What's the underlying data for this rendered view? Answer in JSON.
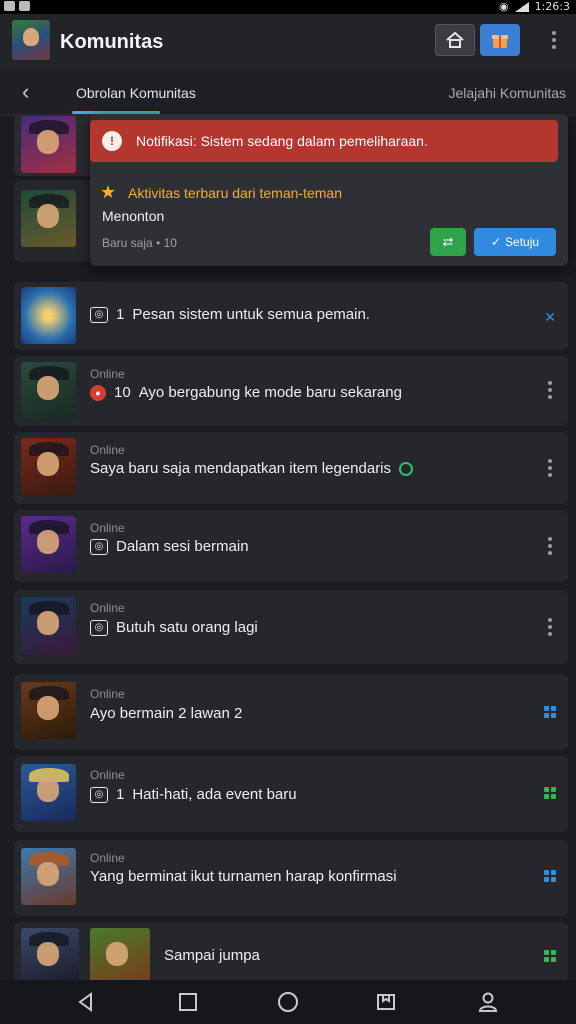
{
  "status_bar": {
    "time": "1:26:3"
  },
  "app": {
    "title": "Komunitas"
  },
  "tabs": [
    {
      "label": "Obrolan Komunitas"
    },
    {
      "label": "Jelajahi Komunitas"
    }
  ],
  "popup": {
    "alert_text": "Notifikasi: Sistem sedang dalam pemeliharaan.",
    "headline": "Aktivitas terbaru dari teman-teman",
    "subtitle": "Menonton",
    "meta": "Baru saja • 10",
    "accept_label": "Setuju"
  },
  "rows": [
    {
      "status": "",
      "badge": "1",
      "message": "Pesan sistem untuk semua pemain."
    },
    {
      "status": "Online",
      "badge": "10",
      "message": "Ayo bergabung ke mode baru sekarang"
    },
    {
      "status": "Online",
      "badge": "",
      "message": "Saya baru saja mendapatkan item legendaris"
    },
    {
      "status": "Online",
      "badge": "",
      "message": "Dalam sesi bermain"
    },
    {
      "status": "Online",
      "badge": "",
      "message": "Butuh satu orang lagi"
    },
    {
      "status": "Online",
      "badge": "",
      "message": "Ayo bermain 2 lawan 2"
    },
    {
      "status": "Online",
      "badge": "1",
      "message": "Hati-hati, ada event baru"
    },
    {
      "status": "Online",
      "badge": "",
      "message": "Yang berminat ikut turnamen harap konfirmasi"
    },
    {
      "status": "",
      "badge": "",
      "message": "Sampai jumpa"
    }
  ],
  "icons": {
    "app_logo": "hero-avatar-icon",
    "home": "home-icon",
    "gift": "gift-icon",
    "more": "more-vertical-icon"
  },
  "colors": {
    "background": "#1b1c20",
    "alert": "#b3362f",
    "accent_blue": "#2f8ae0",
    "accent_green": "#2fa34a",
    "highlight": "#f2b01e"
  }
}
